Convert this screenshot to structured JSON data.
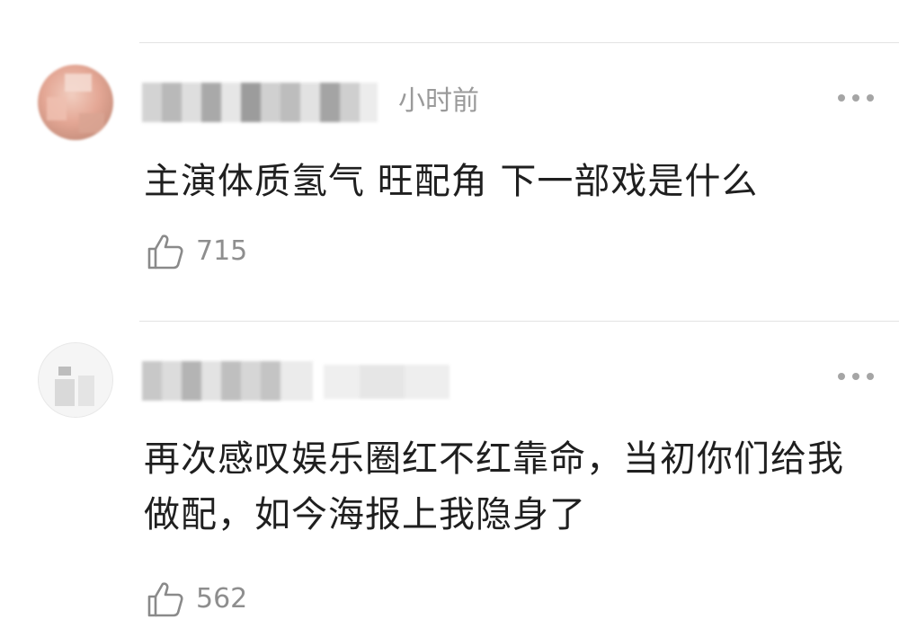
{
  "comments": [
    {
      "time": "小时前",
      "content": "主演体质氢气 旺配角 下一部戏是什么",
      "likes": "715"
    },
    {
      "time": "",
      "content": "再次感叹娱乐圈红不红靠命，当初你们给我做配，如今海报上我隐身了",
      "likes": "562"
    }
  ],
  "icons": {
    "like": "thumbs-up-icon",
    "more": "more-dots-icon"
  },
  "colors": {
    "text": "#1f1f1f",
    "meta": "#9a9a9a",
    "divider": "#e3e3e3"
  }
}
